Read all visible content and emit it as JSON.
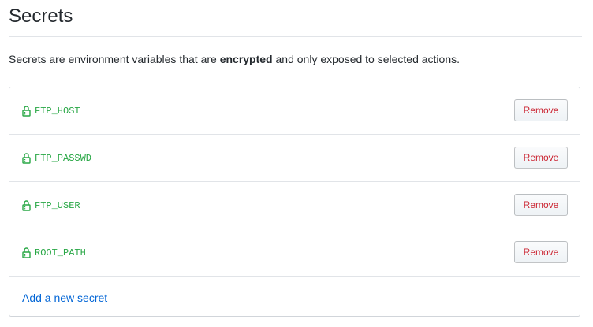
{
  "page": {
    "title": "Secrets",
    "description_before": "Secrets are environment variables that are ",
    "description_emphasis": "encrypted",
    "description_after": " and only exposed to selected actions."
  },
  "secrets": [
    {
      "name": "FTP_HOST",
      "icon": "lock-icon",
      "remove_label": "Remove"
    },
    {
      "name": "FTP_PASSWD",
      "icon": "lock-icon",
      "remove_label": "Remove"
    },
    {
      "name": "FTP_USER",
      "icon": "lock-icon",
      "remove_label": "Remove"
    },
    {
      "name": "ROOT_PATH",
      "icon": "lock-icon",
      "remove_label": "Remove"
    }
  ],
  "add_secret": {
    "label": "Add a new secret"
  },
  "colors": {
    "secret_name": "#28a745",
    "remove_text": "#cb2431",
    "link": "#0366d6",
    "border": "#d1d5da",
    "text": "#24292e"
  }
}
